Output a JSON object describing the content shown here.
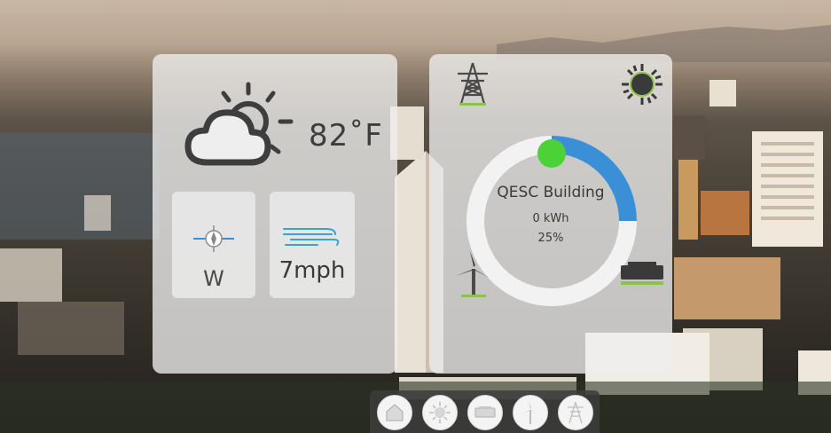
{
  "weather": {
    "temperature": "82˚F",
    "condition_icon": "partly-cloudy-icon",
    "wind_direction": "W",
    "wind_speed": "7mph"
  },
  "energy": {
    "building_name": "QESC Building",
    "energy_value": "0 kWh",
    "percent_label": "25%",
    "percent": 0.25,
    "accent_color": "#3a8fd6",
    "indicator_color": "#4cd137",
    "ring_color": "#f2f2f2",
    "icons": [
      "power-tower-icon",
      "sun-icon",
      "wind-turbine-icon",
      "battery-icon"
    ]
  },
  "dock": {
    "buttons": [
      "home-icon",
      "sun-icon",
      "battery-icon",
      "wind-turbine-icon",
      "power-tower-icon"
    ]
  }
}
